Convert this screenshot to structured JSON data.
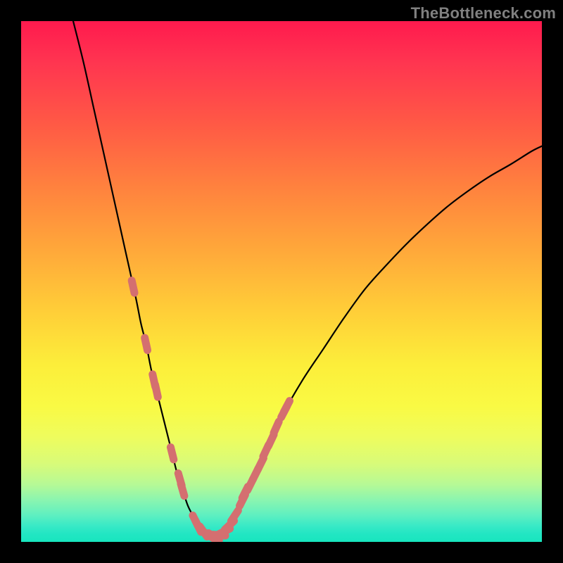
{
  "watermark": "TheBottleneck.com",
  "chart_data": {
    "type": "line",
    "title": "",
    "xlabel": "",
    "ylabel": "",
    "x_range": [
      0,
      100
    ],
    "y_range": [
      0,
      100
    ],
    "curve": {
      "x": [
        10,
        12,
        14,
        16,
        18,
        20,
        22,
        23,
        24,
        25,
        26,
        27,
        28,
        29,
        30,
        31,
        32,
        33,
        34,
        35.5,
        37,
        38,
        39,
        40,
        41,
        42,
        44,
        46,
        48,
        50,
        54,
        58,
        62,
        66,
        70,
        74,
        78,
        82,
        86,
        90,
        94,
        98,
        100
      ],
      "y": [
        100,
        92,
        83,
        74,
        65,
        56,
        47,
        42,
        38,
        33,
        29,
        25,
        21,
        17,
        13,
        10,
        7,
        5,
        3,
        1.5,
        1,
        1.3,
        2,
        3.2,
        5,
        7,
        11,
        15,
        19.5,
        24,
        31,
        37,
        43,
        48.5,
        53,
        57.2,
        61,
        64.5,
        67.5,
        70.2,
        72.5,
        75,
        76
      ]
    },
    "markers": {
      "style": "pill",
      "color": "#d46f70",
      "points": [
        {
          "x": 21.5,
          "y": 49
        },
        {
          "x": 24.0,
          "y": 38
        },
        {
          "x": 25.5,
          "y": 31
        },
        {
          "x": 26.0,
          "y": 29
        },
        {
          "x": 29.0,
          "y": 17
        },
        {
          "x": 30.5,
          "y": 12
        },
        {
          "x": 31.0,
          "y": 10
        },
        {
          "x": 33.5,
          "y": 4
        },
        {
          "x": 34.0,
          "y": 3
        },
        {
          "x": 35.0,
          "y": 2
        },
        {
          "x": 36.0,
          "y": 1.3
        },
        {
          "x": 37.0,
          "y": 1
        },
        {
          "x": 38.0,
          "y": 1.3
        },
        {
          "x": 39.0,
          "y": 2
        },
        {
          "x": 40.0,
          "y": 3.2
        },
        {
          "x": 41.0,
          "y": 5
        },
        {
          "x": 42.5,
          "y": 8
        },
        {
          "x": 43.0,
          "y": 9.5
        },
        {
          "x": 44.0,
          "y": 11
        },
        {
          "x": 45.0,
          "y": 13
        },
        {
          "x": 46.0,
          "y": 15
        },
        {
          "x": 47.0,
          "y": 17.5
        },
        {
          "x": 48.0,
          "y": 19.5
        },
        {
          "x": 49.0,
          "y": 22
        },
        {
          "x": 50.5,
          "y": 25
        },
        {
          "x": 51.0,
          "y": 26
        }
      ]
    },
    "gradient_stops": [
      {
        "pos": 0,
        "color": "#ff1a4e"
      },
      {
        "pos": 50,
        "color": "#ffc83a"
      },
      {
        "pos": 75,
        "color": "#f7fa44"
      },
      {
        "pos": 100,
        "color": "#18e5be"
      }
    ]
  }
}
